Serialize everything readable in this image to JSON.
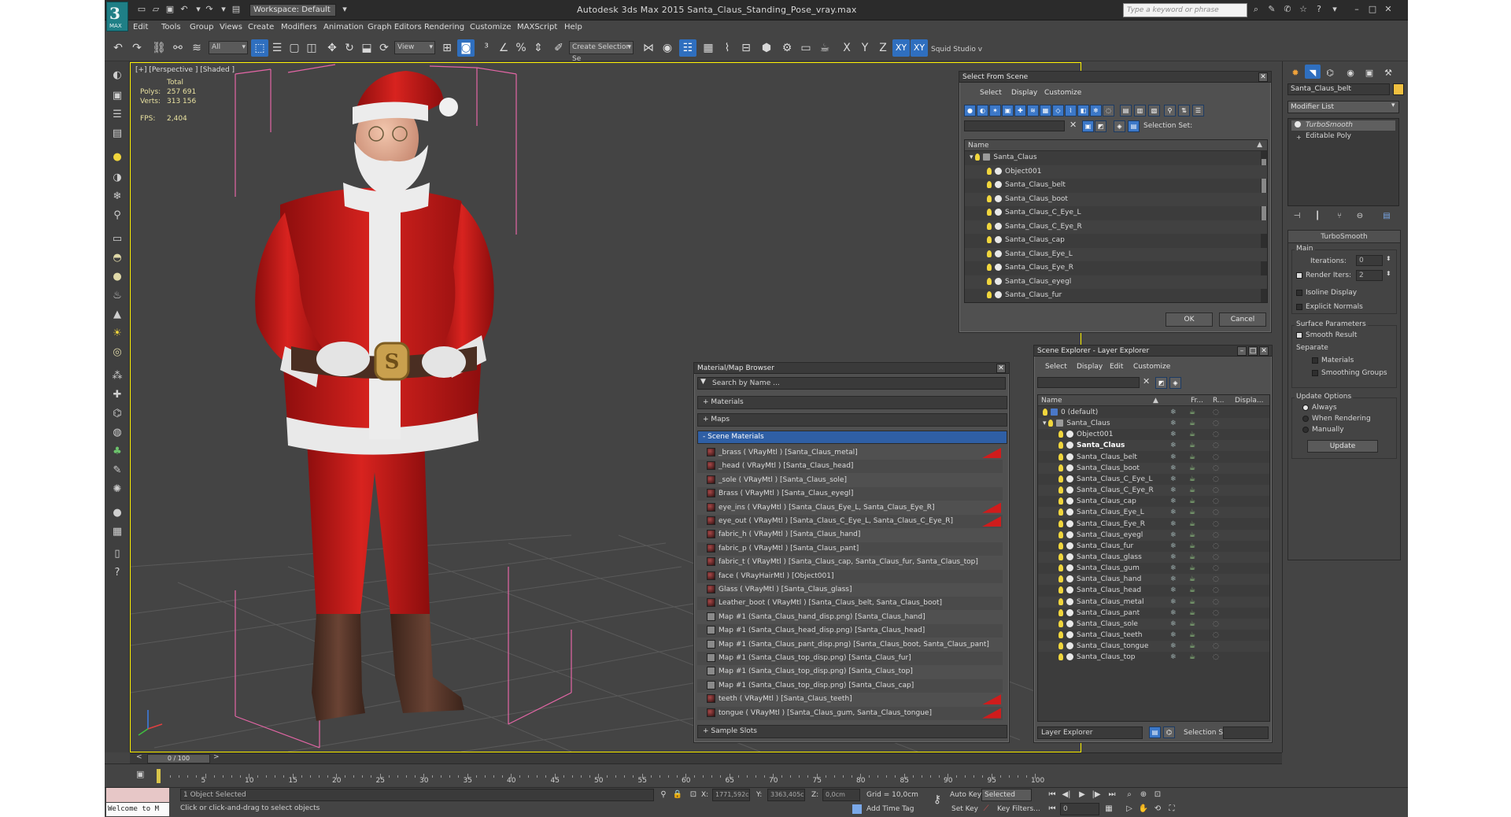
{
  "app": {
    "title": "Autodesk 3ds Max  2015     Santa_Claus_Standing_Pose_vray.max",
    "logo_label": "MAX",
    "workspace": "Workspace: Default",
    "search_placeholder": "Type a keyword or phrase"
  },
  "menu": [
    "Edit",
    "Tools",
    "Group",
    "Views",
    "Create",
    "Modifiers",
    "Animation",
    "Graph Editors",
    "Rendering",
    "Customize",
    "MAXScript",
    "Help"
  ],
  "toolbar": {
    "selection_filter": "All",
    "ref_coord": "View",
    "named_selection": "Create Selection Se",
    "axis_x": "X",
    "axis_y": "Y",
    "axis_z": "Z",
    "axis_xy": "XY",
    "axis_xy2": "XY",
    "plugin_label": "Squid Studio v"
  },
  "viewport": {
    "label": "[+] [Perspective ] [Shaded ]",
    "stats": {
      "total": "Total",
      "polys_label": "Polys:",
      "polys": "257 691",
      "verts_label": "Verts:",
      "verts": "313 156",
      "fps_label": "FPS:",
      "fps": "2,404"
    }
  },
  "select_from_scene": {
    "title": "Select From Scene",
    "menu": [
      "Select",
      "Display",
      "Customize"
    ],
    "selection_set_label": "Selection Set:",
    "column_name": "Name",
    "items": [
      "Santa_Claus",
      "Object001",
      "Santa_Claus_belt",
      "Santa_Claus_boot",
      "Santa_Claus_C_Eye_L",
      "Santa_Claus_C_Eye_R",
      "Santa_Claus_cap",
      "Santa_Claus_Eye_L",
      "Santa_Claus_Eye_R",
      "Santa_Claus_eyegl",
      "Santa_Claus_fur"
    ],
    "ok_label": "OK",
    "cancel_label": "Cancel"
  },
  "material_browser": {
    "title": "Material/Map Browser",
    "search_placeholder": "Search by Name ...",
    "sections": {
      "materials": "+ Materials",
      "maps": "+ Maps",
      "scene_materials": "- Scene Materials",
      "sample_slots": "+ Sample Slots"
    },
    "items": [
      {
        "text": "_brass  ( VRayMtl ) [Santa_Claus_metal]",
        "flag": true,
        "map": false
      },
      {
        "text": "_head  ( VRayMtl ) [Santa_Claus_head]",
        "flag": false,
        "map": false
      },
      {
        "text": "_sole  ( VRayMtl ) [Santa_Claus_sole]",
        "flag": false,
        "map": false
      },
      {
        "text": "Brass  ( VRayMtl ) [Santa_Claus_eyegl]",
        "flag": false,
        "map": false
      },
      {
        "text": "eye_ins  ( VRayMtl ) [Santa_Claus_Eye_L, Santa_Claus_Eye_R]",
        "flag": true,
        "map": false
      },
      {
        "text": "eye_out  ( VRayMtl ) [Santa_Claus_C_Eye_L, Santa_Claus_C_Eye_R]",
        "flag": true,
        "map": false
      },
      {
        "text": "fabric_h  ( VRayMtl ) [Santa_Claus_hand]",
        "flag": false,
        "map": false
      },
      {
        "text": "fabric_p  ( VRayMtl ) [Santa_Claus_pant]",
        "flag": false,
        "map": false
      },
      {
        "text": "fabric_t  ( VRayMtl ) [Santa_Claus_cap, Santa_Claus_fur, Santa_Claus_top]",
        "flag": false,
        "map": false
      },
      {
        "text": "face  ( VRayHairMtl ) [Object001]",
        "flag": false,
        "map": false
      },
      {
        "text": "Glass  ( VRayMtl ) [Santa_Claus_glass]",
        "flag": false,
        "map": false
      },
      {
        "text": "Leather_boot  ( VRayMtl ) [Santa_Claus_belt, Santa_Claus_boot]",
        "flag": false,
        "map": false
      },
      {
        "text": "Map #1 (Santa_Claus_hand_disp.png) [Santa_Claus_hand]",
        "flag": false,
        "map": true
      },
      {
        "text": "Map #1 (Santa_Claus_head_disp.png) [Santa_Claus_head]",
        "flag": false,
        "map": true
      },
      {
        "text": "Map #1 (Santa_Claus_pant_disp.png) [Santa_Claus_boot, Santa_Claus_pant]",
        "flag": false,
        "map": true
      },
      {
        "text": "Map #1 (Santa_Claus_top_disp.png) [Santa_Claus_fur]",
        "flag": false,
        "map": true
      },
      {
        "text": "Map #1 (Santa_Claus_top_disp.png) [Santa_Claus_top]",
        "flag": false,
        "map": true
      },
      {
        "text": "Map #1 (Santa_Claus_top_disp.png) [Santa_Claus_cap]",
        "flag": false,
        "map": true
      },
      {
        "text": "teeth  ( VRayMtl ) [Santa_Claus_teeth]",
        "flag": true,
        "map": false
      },
      {
        "text": "tongue  ( VRayMtl ) [Santa_Claus_gum, Santa_Claus_tongue]",
        "flag": true,
        "map": false
      }
    ]
  },
  "scene_explorer": {
    "title": "Scene Explorer - Layer Explorer",
    "menu": [
      "Select",
      "Display",
      "Edit",
      "Customize"
    ],
    "columns": {
      "name": "Name",
      "fr": "Fr...",
      "r": "R...",
      "display": "Displa..."
    },
    "items": [
      {
        "name": "0 (default)",
        "indent": 1,
        "type": "layer"
      },
      {
        "name": "Santa_Claus",
        "indent": 1,
        "type": "layer"
      },
      {
        "name": "Object001",
        "indent": 2,
        "type": "obj"
      },
      {
        "name": "Santa_Claus",
        "indent": 2,
        "type": "obj",
        "selected": true
      },
      {
        "name": "Santa_Claus_belt",
        "indent": 2,
        "type": "obj"
      },
      {
        "name": "Santa_Claus_boot",
        "indent": 2,
        "type": "obj"
      },
      {
        "name": "Santa_Claus_C_Eye_L",
        "indent": 2,
        "type": "obj"
      },
      {
        "name": "Santa_Claus_C_Eye_R",
        "indent": 2,
        "type": "obj"
      },
      {
        "name": "Santa_Claus_cap",
        "indent": 2,
        "type": "obj"
      },
      {
        "name": "Santa_Claus_Eye_L",
        "indent": 2,
        "type": "obj"
      },
      {
        "name": "Santa_Claus_Eye_R",
        "indent": 2,
        "type": "obj"
      },
      {
        "name": "Santa_Claus_eyegl",
        "indent": 2,
        "type": "obj"
      },
      {
        "name": "Santa_Claus_fur",
        "indent": 2,
        "type": "obj"
      },
      {
        "name": "Santa_Claus_glass",
        "indent": 2,
        "type": "obj"
      },
      {
        "name": "Santa_Claus_gum",
        "indent": 2,
        "type": "obj"
      },
      {
        "name": "Santa_Claus_hand",
        "indent": 2,
        "type": "obj"
      },
      {
        "name": "Santa_Claus_head",
        "indent": 2,
        "type": "obj"
      },
      {
        "name": "Santa_Claus_metal",
        "indent": 2,
        "type": "obj"
      },
      {
        "name": "Santa_Claus_pant",
        "indent": 2,
        "type": "obj"
      },
      {
        "name": "Santa_Claus_sole",
        "indent": 2,
        "type": "obj"
      },
      {
        "name": "Santa_Claus_teeth",
        "indent": 2,
        "type": "obj"
      },
      {
        "name": "Santa_Claus_tongue",
        "indent": 2,
        "type": "obj"
      },
      {
        "name": "Santa_Claus_top",
        "indent": 2,
        "type": "obj"
      }
    ],
    "footer_dropdown": "Layer Explorer",
    "selection_set_label": "Selection Set:"
  },
  "command_panel": {
    "object_name": "Santa_Claus_belt",
    "object_color": "#f0c040",
    "modifier_list": "Modifier List",
    "stack": [
      "TurboSmooth",
      "Editable Poly"
    ],
    "rollout_title": "TurboSmooth",
    "main_label": "Main",
    "iterations_label": "Iterations:",
    "iterations": "0",
    "render_iters_label": "Render Iters:",
    "render_iters": "2",
    "isoline_label": "Isoline Display",
    "explicit_normals_label": "Explicit Normals",
    "surface_params_label": "Surface Parameters",
    "smooth_result_label": "Smooth Result",
    "separate_label": "Separate",
    "materials_label": "Materials",
    "smoothing_groups_label": "Smoothing Groups",
    "update_options_label": "Update Options",
    "always_label": "Always",
    "when_rendering_label": "When Rendering",
    "manually_label": "Manually",
    "update_button": "Update"
  },
  "timeline": {
    "frame_counter": "0 / 100",
    "ticks": [
      "5",
      "10",
      "15",
      "20",
      "25",
      "30",
      "35",
      "40",
      "45",
      "50",
      "55",
      "60",
      "65",
      "70",
      "75",
      "80",
      "85",
      "90",
      "95",
      "100"
    ]
  },
  "status": {
    "welcome": "Welcome to M",
    "selected_text": "1 Object Selected",
    "prompt_text": "Click or click-and-drag to select objects",
    "x_label": "X:",
    "x_value": "1771,592c",
    "y_label": "Y:",
    "y_value": "3363,405c",
    "z_label": "Z:",
    "z_value": "0,0cm",
    "grid": "Grid = 10,0cm",
    "add_time_tag": "Add Time Tag",
    "auto_key": "Auto Key",
    "set_key": "Set Key",
    "selected_dropdown": "Selected",
    "key_filters": "Key Filters...",
    "frame_value": "0"
  }
}
